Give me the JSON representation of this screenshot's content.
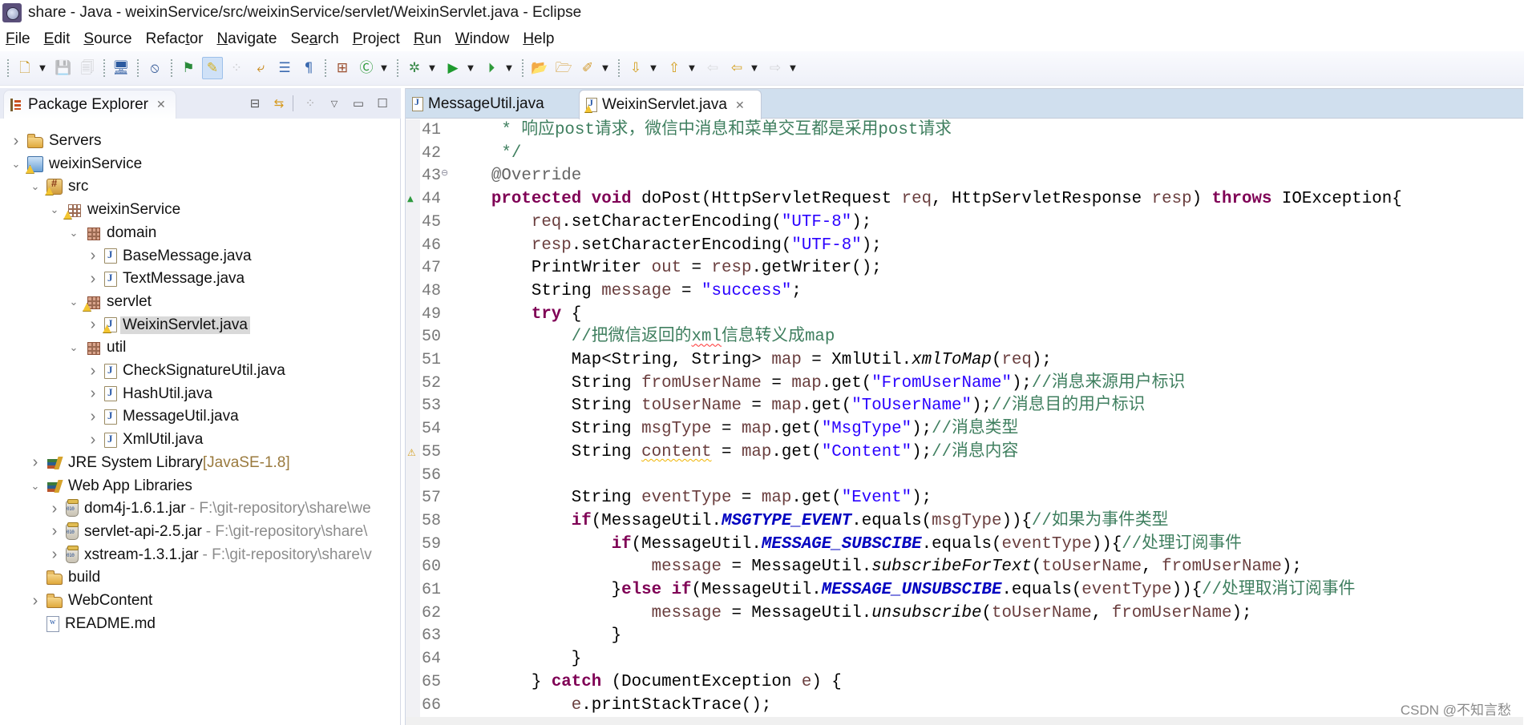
{
  "window": {
    "title": "share - Java - weixinService/src/weixinService/servlet/WeixinServlet.java - Eclipse",
    "app_icon": "eclipse-icon"
  },
  "menubar": {
    "items": [
      {
        "label": "File",
        "mnemonic_index": 0
      },
      {
        "label": "Edit",
        "mnemonic_index": 0
      },
      {
        "label": "Source",
        "mnemonic_index": 0
      },
      {
        "label": "Refactor",
        "mnemonic_index": 5
      },
      {
        "label": "Navigate",
        "mnemonic_index": 0
      },
      {
        "label": "Search",
        "mnemonic_index": 2
      },
      {
        "label": "Project",
        "mnemonic_index": 0
      },
      {
        "label": "Run",
        "mnemonic_index": 0
      },
      {
        "label": "Window",
        "mnemonic_index": 0
      },
      {
        "label": "Help",
        "mnemonic_index": 0
      }
    ]
  },
  "toolbar": {
    "groups": [
      [
        {
          "icon": "new-wizard-icon",
          "glyph": "🗋",
          "dropdown": true
        },
        {
          "icon": "save-icon",
          "glyph": "💾",
          "disabled": true
        },
        {
          "icon": "save-all-icon",
          "glyph": "🗐",
          "disabled": true
        }
      ],
      [
        {
          "icon": "open-console-icon",
          "glyph": "🖥"
        }
      ],
      [
        {
          "icon": "skip-breakpoints-icon",
          "glyph": "⦸"
        }
      ],
      [
        {
          "icon": "new-server-icon",
          "glyph": "⚑"
        },
        {
          "icon": "mark-occurrences-icon",
          "glyph": "✎",
          "pressed": true
        },
        {
          "icon": "toggle-block-selection-icon",
          "glyph": "⁘",
          "disabled": true
        },
        {
          "icon": "toggle-word-wrap-icon",
          "glyph": "⤶"
        },
        {
          "icon": "breadcrumb-icon",
          "glyph": "☰"
        },
        {
          "icon": "show-whitespace-icon",
          "glyph": "¶"
        }
      ],
      [
        {
          "icon": "new-java-package-icon",
          "glyph": "⊞"
        },
        {
          "icon": "new-java-class-icon",
          "glyph": "Ⓒ",
          "dropdown": true
        }
      ],
      [
        {
          "icon": "debug-icon",
          "glyph": "✲",
          "dropdown": true
        },
        {
          "icon": "run-icon",
          "glyph": "▶",
          "dropdown": true
        },
        {
          "icon": "run-external-tools-icon",
          "glyph": "⏵",
          "dropdown": true
        }
      ],
      [
        {
          "icon": "open-type-icon",
          "glyph": "📂"
        },
        {
          "icon": "open-task-icon",
          "glyph": "🗁"
        },
        {
          "icon": "search-icon",
          "glyph": "✐",
          "dropdown": true
        }
      ],
      [
        {
          "icon": "next-annotation-icon",
          "glyph": "⇩",
          "dropdown": true
        },
        {
          "icon": "previous-annotation-icon",
          "glyph": "⇧",
          "dropdown": true
        },
        {
          "icon": "last-edit-location-icon",
          "glyph": "⇦",
          "disabled": true
        },
        {
          "icon": "back-icon",
          "glyph": "⇦",
          "dropdown": true
        },
        {
          "icon": "forward-icon",
          "glyph": "⇨",
          "dropdown": true,
          "disabled": true
        }
      ]
    ]
  },
  "package_explorer": {
    "title": "Package Explorer",
    "view_actions": [
      "collapse-all-icon",
      "link-with-editor-icon",
      "focus-active-task-icon",
      "view-menu-icon",
      "minimize-icon",
      "maximize-icon"
    ],
    "tree": [
      {
        "label": "Servers",
        "depth": 0,
        "twisty": "collapsed",
        "icon": "folder"
      },
      {
        "label": "weixinService",
        "depth": 0,
        "twisty": "expanded",
        "icon": "project"
      },
      {
        "label": "src",
        "depth": 1,
        "twisty": "expanded",
        "icon": "srcfolder",
        "warn": true
      },
      {
        "label": "weixinService",
        "depth": 2,
        "twisty": "expanded",
        "icon": "package",
        "warn": true
      },
      {
        "label": "domain",
        "depth": 3,
        "twisty": "expanded",
        "icon": "package-filled"
      },
      {
        "label": "BaseMessage.java",
        "depth": 4,
        "twisty": "collapsed",
        "icon": "java"
      },
      {
        "label": "TextMessage.java",
        "depth": 4,
        "twisty": "collapsed",
        "icon": "java"
      },
      {
        "label": "servlet",
        "depth": 3,
        "twisty": "expanded",
        "icon": "package-filled",
        "warn": true
      },
      {
        "label": "WeixinServlet.java",
        "depth": 4,
        "twisty": "collapsed",
        "icon": "java",
        "warn": true,
        "selected": true
      },
      {
        "label": "util",
        "depth": 3,
        "twisty": "expanded",
        "icon": "package-filled"
      },
      {
        "label": "CheckSignatureUtil.java",
        "depth": 4,
        "twisty": "collapsed",
        "icon": "java"
      },
      {
        "label": "HashUtil.java",
        "depth": 4,
        "twisty": "collapsed",
        "icon": "java"
      },
      {
        "label": "MessageUtil.java",
        "depth": 4,
        "twisty": "collapsed",
        "icon": "java"
      },
      {
        "label": "XmlUtil.java",
        "depth": 4,
        "twisty": "collapsed",
        "icon": "java"
      },
      {
        "label": "JRE System Library",
        "decoration": "[JavaSE-1.8]",
        "depth": 1,
        "twisty": "collapsed",
        "icon": "library"
      },
      {
        "label": "Web App Libraries",
        "depth": 1,
        "twisty": "expanded",
        "icon": "library"
      },
      {
        "label": "dom4j-1.6.1.jar",
        "path": "- F:\\git-repository\\share\\we",
        "depth": 2,
        "twisty": "collapsed",
        "icon": "jar"
      },
      {
        "label": "servlet-api-2.5.jar",
        "path": "- F:\\git-repository\\share\\",
        "depth": 2,
        "twisty": "collapsed",
        "icon": "jar"
      },
      {
        "label": "xstream-1.3.1.jar",
        "path": "- F:\\git-repository\\share\\v",
        "depth": 2,
        "twisty": "collapsed",
        "icon": "jar"
      },
      {
        "label": "build",
        "depth": 1,
        "twisty": "none",
        "icon": "folder"
      },
      {
        "label": "WebContent",
        "depth": 1,
        "twisty": "collapsed",
        "icon": "folder"
      },
      {
        "label": "README.md",
        "depth": 1,
        "twisty": "none",
        "icon": "file"
      }
    ]
  },
  "editor": {
    "tabs": [
      {
        "label": "MessageUtil.java",
        "active": false
      },
      {
        "label": "WeixinServlet.java",
        "active": true,
        "warn": true
      }
    ],
    "lines": [
      {
        "n": 41,
        "tokens": [
          [
            "     * 响应post请求，微信中消息和菜单交互都是采用post请求",
            "cmt"
          ]
        ]
      },
      {
        "n": 42,
        "tokens": [
          [
            "     */",
            "cmt"
          ]
        ]
      },
      {
        "n": 43,
        "fold": true,
        "tokens": [
          [
            "    ",
            ""
          ],
          [
            "@Override",
            "ann"
          ]
        ]
      },
      {
        "n": 44,
        "override_marker": true,
        "tokens": [
          [
            "    ",
            ""
          ],
          [
            "protected",
            "kw"
          ],
          [
            " ",
            ""
          ],
          [
            "void",
            "kw"
          ],
          [
            " doPost(HttpServletRequest ",
            ""
          ],
          [
            "req",
            "var"
          ],
          [
            ", HttpServletResponse ",
            ""
          ],
          [
            "resp",
            "var"
          ],
          [
            ") ",
            ""
          ],
          [
            "throws",
            "kw"
          ],
          [
            " IOException{",
            ""
          ]
        ]
      },
      {
        "n": 45,
        "tokens": [
          [
            "        ",
            ""
          ],
          [
            "req",
            "var"
          ],
          [
            ".setCharacterEncoding(",
            ""
          ],
          [
            "\"UTF-8\"",
            "str"
          ],
          [
            ");",
            ""
          ]
        ]
      },
      {
        "n": 46,
        "tokens": [
          [
            "        ",
            ""
          ],
          [
            "resp",
            "var"
          ],
          [
            ".setCharacterEncoding(",
            ""
          ],
          [
            "\"UTF-8\"",
            "str"
          ],
          [
            ");",
            ""
          ]
        ]
      },
      {
        "n": 47,
        "tokens": [
          [
            "        PrintWriter ",
            ""
          ],
          [
            "out",
            "var"
          ],
          [
            " = ",
            ""
          ],
          [
            "resp",
            "var"
          ],
          [
            ".getWriter();",
            ""
          ]
        ]
      },
      {
        "n": 48,
        "tokens": [
          [
            "        String ",
            ""
          ],
          [
            "message",
            "var"
          ],
          [
            " = ",
            ""
          ],
          [
            "\"success\"",
            "str"
          ],
          [
            ";",
            ""
          ]
        ]
      },
      {
        "n": 49,
        "tokens": [
          [
            "        ",
            ""
          ],
          [
            "try",
            "kw"
          ],
          [
            " {",
            ""
          ]
        ]
      },
      {
        "n": 50,
        "tokens": [
          [
            "            //把微信返回的",
            "cmt"
          ],
          [
            "xml",
            "cmt err"
          ],
          [
            "信息转义成map",
            "cmt"
          ]
        ]
      },
      {
        "n": 51,
        "tokens": [
          [
            "            Map<String, String> ",
            ""
          ],
          [
            "map",
            "var"
          ],
          [
            " = XmlUtil.",
            ""
          ],
          [
            "xmlToMap",
            "smeth"
          ],
          [
            "(",
            ""
          ],
          [
            "req",
            "var"
          ],
          [
            ");",
            ""
          ]
        ]
      },
      {
        "n": 52,
        "tokens": [
          [
            "            String ",
            ""
          ],
          [
            "fromUserName",
            "var"
          ],
          [
            " = ",
            ""
          ],
          [
            "map",
            "var"
          ],
          [
            ".get(",
            ""
          ],
          [
            "\"FromUserName\"",
            "str"
          ],
          [
            ");",
            ""
          ],
          [
            "//消息来源用户标识",
            "cmt"
          ]
        ]
      },
      {
        "n": 53,
        "tokens": [
          [
            "            String ",
            ""
          ],
          [
            "toUserName",
            "var"
          ],
          [
            " = ",
            ""
          ],
          [
            "map",
            "var"
          ],
          [
            ".get(",
            ""
          ],
          [
            "\"ToUserName\"",
            "str"
          ],
          [
            ");",
            ""
          ],
          [
            "//消息目的用户标识",
            "cmt"
          ]
        ]
      },
      {
        "n": 54,
        "tokens": [
          [
            "            String ",
            ""
          ],
          [
            "msgType",
            "var"
          ],
          [
            " = ",
            ""
          ],
          [
            "map",
            "var"
          ],
          [
            ".get(",
            ""
          ],
          [
            "\"MsgType\"",
            "str"
          ],
          [
            ");",
            ""
          ],
          [
            "//消息类型",
            "cmt"
          ]
        ]
      },
      {
        "n": 55,
        "warning_marker": true,
        "tokens": [
          [
            "            String ",
            ""
          ],
          [
            "content",
            "var warn"
          ],
          [
            " = ",
            ""
          ],
          [
            "map",
            "var"
          ],
          [
            ".get(",
            ""
          ],
          [
            "\"Content\"",
            "str"
          ],
          [
            ");",
            ""
          ],
          [
            "//消息内容",
            "cmt"
          ]
        ]
      },
      {
        "n": 56,
        "tokens": []
      },
      {
        "n": 57,
        "tokens": [
          [
            "            String ",
            ""
          ],
          [
            "eventType",
            "var"
          ],
          [
            " = ",
            ""
          ],
          [
            "map",
            "var"
          ],
          [
            ".get(",
            ""
          ],
          [
            "\"Event\"",
            "str"
          ],
          [
            ");",
            ""
          ]
        ]
      },
      {
        "n": 58,
        "tokens": [
          [
            "            ",
            ""
          ],
          [
            "if",
            "kw"
          ],
          [
            "(MessageUtil.",
            ""
          ],
          [
            "MSGTYPE_EVENT",
            "static"
          ],
          [
            ".equals(",
            ""
          ],
          [
            "msgType",
            "var"
          ],
          [
            "))",
            ""
          ],
          [
            "{",
            ""
          ],
          [
            "//如果为事件类型",
            "cmt"
          ]
        ]
      },
      {
        "n": 59,
        "tokens": [
          [
            "                ",
            ""
          ],
          [
            "if",
            "kw"
          ],
          [
            "(MessageUtil.",
            ""
          ],
          [
            "MESSAGE_SUBSCIBE",
            "static"
          ],
          [
            ".equals(",
            ""
          ],
          [
            "eventType",
            "var"
          ],
          [
            "))",
            ""
          ],
          [
            "{",
            ""
          ],
          [
            "//处理订阅事件",
            "cmt"
          ]
        ]
      },
      {
        "n": 60,
        "tokens": [
          [
            "                    ",
            ""
          ],
          [
            "message",
            "var"
          ],
          [
            " = MessageUtil.",
            ""
          ],
          [
            "subscribeForText",
            "smeth"
          ],
          [
            "(",
            ""
          ],
          [
            "toUserName",
            "var"
          ],
          [
            ", ",
            ""
          ],
          [
            "fromUserName",
            "var"
          ],
          [
            ");",
            ""
          ]
        ]
      },
      {
        "n": 61,
        "tokens": [
          [
            "                }",
            ""
          ],
          [
            "else",
            "kw"
          ],
          [
            " ",
            ""
          ],
          [
            "if",
            "kw"
          ],
          [
            "(MessageUtil.",
            ""
          ],
          [
            "MESSAGE_UNSUBSCIBE",
            "static"
          ],
          [
            ".equals(",
            ""
          ],
          [
            "eventType",
            "var"
          ],
          [
            "))",
            ""
          ],
          [
            "{",
            ""
          ],
          [
            "//处理取消订阅事件",
            "cmt"
          ]
        ]
      },
      {
        "n": 62,
        "tokens": [
          [
            "                    ",
            ""
          ],
          [
            "message",
            "var"
          ],
          [
            " = MessageUtil.",
            ""
          ],
          [
            "unsubscribe",
            "smeth"
          ],
          [
            "(",
            ""
          ],
          [
            "toUserName",
            "var"
          ],
          [
            ", ",
            ""
          ],
          [
            "fromUserName",
            "var"
          ],
          [
            ");",
            ""
          ]
        ]
      },
      {
        "n": 63,
        "tokens": [
          [
            "                }",
            ""
          ]
        ]
      },
      {
        "n": 64,
        "tokens": [
          [
            "            }",
            ""
          ]
        ]
      },
      {
        "n": 65,
        "tokens": [
          [
            "        } ",
            ""
          ],
          [
            "catch",
            "kw"
          ],
          [
            " (DocumentException ",
            ""
          ],
          [
            "e",
            "var"
          ],
          [
            ") {",
            ""
          ]
        ]
      },
      {
        "n": 66,
        "tokens": [
          [
            "            ",
            ""
          ],
          [
            "e",
            "var"
          ],
          [
            ".printStackTrace();",
            ""
          ]
        ]
      }
    ]
  },
  "colors": {
    "keyword": "#7f0055",
    "string": "#2a00ff",
    "local_variable": "#6a3e3e",
    "comment": "#3f7f5f",
    "static_field": "#0000c0",
    "editor_tabbar": "#d0dfee"
  },
  "watermark": "CSDN @不知言愁"
}
